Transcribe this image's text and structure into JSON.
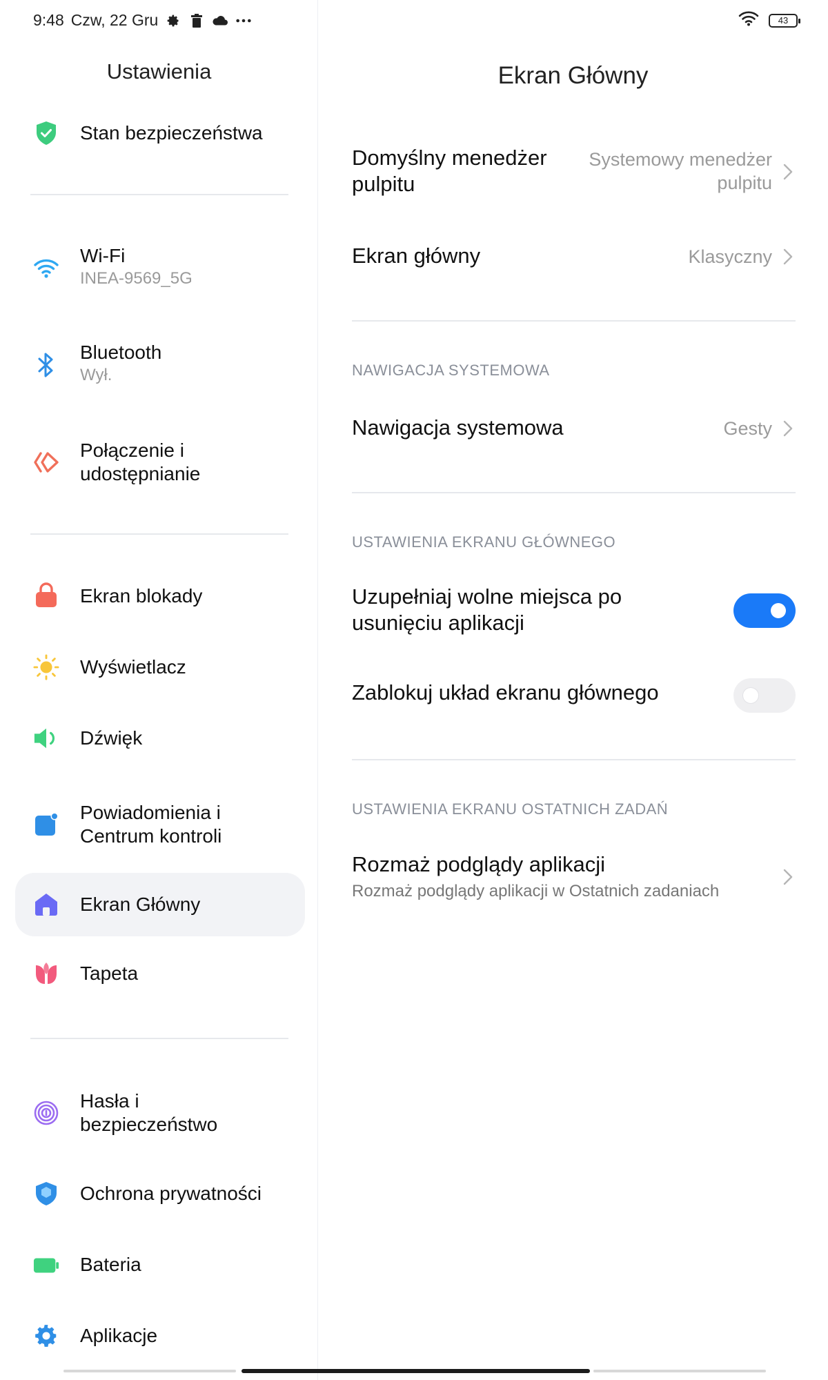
{
  "status_bar": {
    "time": "9:48",
    "date": "Czw, 22 Gru",
    "battery": "43",
    "icons": [
      "gear-icon",
      "trash-icon",
      "cloud-icon",
      "more-icon",
      "wifi-icon",
      "battery-icon"
    ]
  },
  "sidebar": {
    "title": "Ustawienia",
    "items": [
      {
        "label": "Stan bezpieczeństwa",
        "sub": "",
        "icon": "shield-check-icon",
        "color": "#3dcc7e"
      },
      {
        "label": "Wi-Fi",
        "sub": "INEA-9569_5G",
        "icon": "wifi-icon",
        "color": "#2ea8f2"
      },
      {
        "label": "Bluetooth",
        "sub": "Wył.",
        "icon": "bluetooth-icon",
        "color": "#2f8fe6"
      },
      {
        "label": "Połączenie i udostępnianie",
        "sub": "",
        "icon": "connection-sharing-icon",
        "color": "#f0705a"
      },
      {
        "label": "Ekran blokady",
        "sub": "",
        "icon": "lock-icon",
        "color": "#f46a5a"
      },
      {
        "label": "Wyświetlacz",
        "sub": "",
        "icon": "sun-icon",
        "color": "#f8c63a"
      },
      {
        "label": "Dźwięk",
        "sub": "",
        "icon": "speaker-icon",
        "color": "#3fd27f"
      },
      {
        "label": "Powiadomienia i Centrum kontroli",
        "sub": "",
        "icon": "notification-icon",
        "color": "#2f8fe6"
      },
      {
        "label": "Ekran Główny",
        "sub": "",
        "icon": "home-icon",
        "color": "#6a6af5",
        "active": true
      },
      {
        "label": "Tapeta",
        "sub": "",
        "icon": "tulip-icon",
        "color": "#f25a7d"
      },
      {
        "label": "Hasła i bezpieczeństwo",
        "sub": "",
        "icon": "fingerprint-icon",
        "color": "#9b6cf1"
      },
      {
        "label": "Ochrona prywatności",
        "sub": "",
        "icon": "privacy-shield-icon",
        "color": "#2f8fe6"
      },
      {
        "label": "Bateria",
        "sub": "",
        "icon": "battery-icon",
        "color": "#3fd27f"
      },
      {
        "label": "Aplikacje",
        "sub": "",
        "icon": "apps-gear-icon",
        "color": "#2f8fe6"
      }
    ]
  },
  "main": {
    "title": "Ekran Główny",
    "default_launcher": {
      "label": "Domyślny menedżer pulpitu",
      "value": "Systemowy menedżer pulpitu"
    },
    "home_screen": {
      "label": "Ekran główny",
      "value": "Klasyczny"
    },
    "section_navigation": "NAWIGACJA SYSTEMOWA",
    "system_navigation": {
      "label": "Nawigacja systemowa",
      "value": "Gesty"
    },
    "section_home_settings": "USTAWIENIA EKRANU GŁÓWNEGO",
    "fill_gaps": {
      "label": "Uzupełniaj wolne miejsca po usunięciu aplikacji",
      "enabled": true
    },
    "lock_layout": {
      "label": "Zablokuj układ ekranu głównego",
      "enabled": false
    },
    "section_recents": "USTAWIENIA EKRANU OSTATNICH ZADAŃ",
    "blur_previews": {
      "label": "Rozmaż podglądy aplikacji",
      "sub": "Rozmaż podglądy aplikacji w Ostatnich zadaniach"
    }
  }
}
